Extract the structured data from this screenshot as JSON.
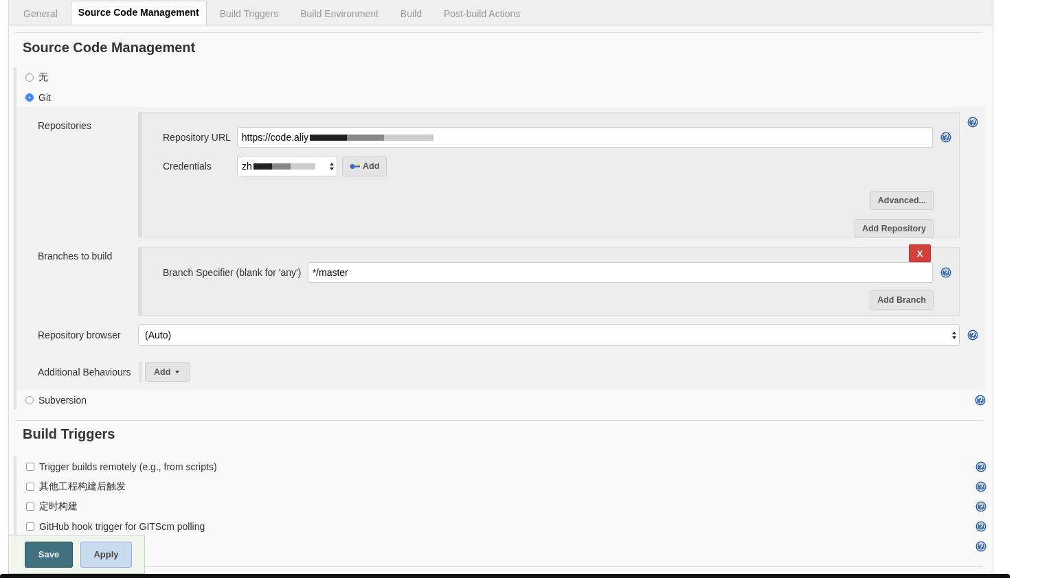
{
  "tabs": [
    {
      "label": "General",
      "selected": false
    },
    {
      "label": "Source Code Management",
      "selected": true
    },
    {
      "label": "Build Triggers",
      "selected": false
    },
    {
      "label": "Build Environment",
      "selected": false
    },
    {
      "label": "Build",
      "selected": false
    },
    {
      "label": "Post-build Actions",
      "selected": false
    }
  ],
  "scm": {
    "title": "Source Code Management",
    "options": [
      {
        "label": "无",
        "selected": false
      },
      {
        "label": "Git",
        "selected": true
      },
      {
        "label": "Subversion",
        "selected": false
      }
    ],
    "git": {
      "repositories_label": "Repositories",
      "repository_url_label": "Repository URL",
      "repository_url": "https://code.aliy",
      "credentials_label": "Credentials",
      "credentials": "zh",
      "add_credentials": "Add",
      "advanced": "Advanced...",
      "add_repository": "Add Repository",
      "branches_label": "Branches to build",
      "delete_branch": "X",
      "branch_specifier_label": "Branch Specifier (blank for 'any')",
      "branch_specifier": "*/master",
      "add_branch": "Add Branch",
      "repository_browser_label": "Repository browser",
      "repository_browser": "(Auto)",
      "behaviours_label": "Additional Behaviours",
      "add_behaviour": "Add"
    }
  },
  "build_triggers": {
    "title": "Build Triggers",
    "items": [
      {
        "kind": "checkbox",
        "label": "Trigger builds remotely (e.g., from scripts)",
        "checked": false
      },
      {
        "kind": "checkbox",
        "label": "其他工程构建后触发",
        "checked": false
      },
      {
        "kind": "checkbox",
        "label": "定时构建",
        "checked": false
      },
      {
        "kind": "checkbox",
        "label": "GitHub hook trigger for GITScm polling",
        "checked": false
      },
      {
        "kind": "covered"
      }
    ]
  },
  "actions": {
    "save": "Save",
    "apply": "Apply"
  }
}
